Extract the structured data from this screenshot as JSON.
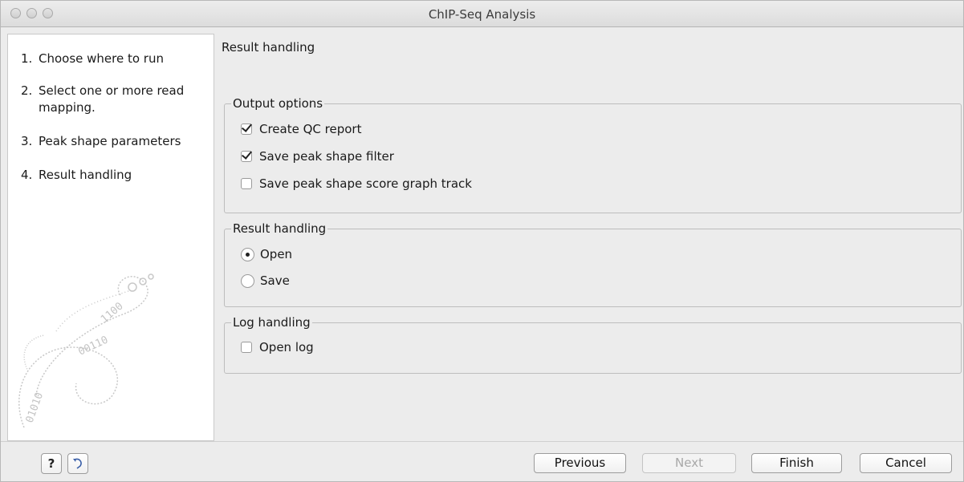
{
  "window": {
    "title": "ChIP-Seq Analysis"
  },
  "steps": [
    {
      "num": "1.",
      "label": "Choose where to run"
    },
    {
      "num": "2.",
      "label": "Select one or more read mapping."
    },
    {
      "num": "3.",
      "label": "Peak shape parameters"
    },
    {
      "num": "4.",
      "label": "Result handling"
    }
  ],
  "content": {
    "section_title": "Result handling",
    "output_options": {
      "label": "Output options",
      "create_qc_report": {
        "label": "Create QC report",
        "checked": true
      },
      "save_peak_shape_filter": {
        "label": "Save peak shape filter",
        "checked": true
      },
      "save_peak_shape_score_graph": {
        "label": "Save peak shape score graph track",
        "checked": false
      }
    },
    "result_handling": {
      "label": "Result handling",
      "open": {
        "label": "Open",
        "selected": true
      },
      "save": {
        "label": "Save",
        "selected": false
      }
    },
    "log_handling": {
      "label": "Log handling",
      "open_log": {
        "label": "Open log",
        "checked": false
      }
    }
  },
  "footer": {
    "help_icon": "help-icon",
    "reset_icon": "reset-icon",
    "help_glyph": "?",
    "previous_label": "Previous",
    "next_label": "Next",
    "finish_label": "Finish",
    "cancel_label": "Cancel"
  }
}
